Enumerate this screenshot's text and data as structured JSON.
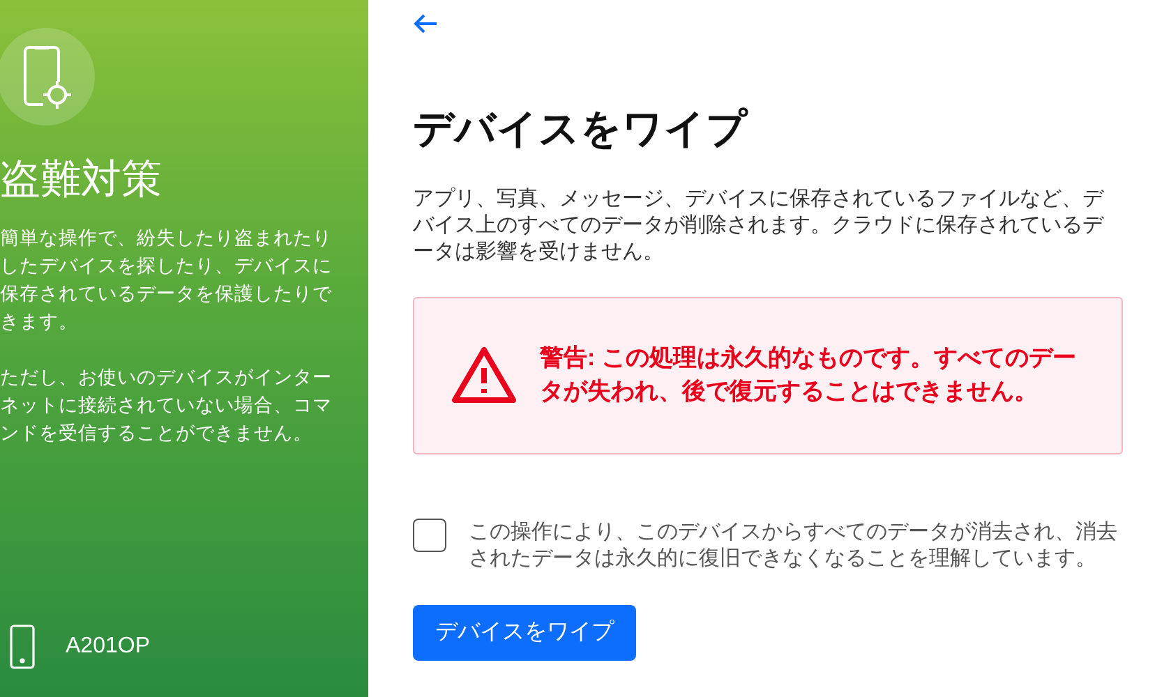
{
  "sidebar": {
    "title": "盗難対策",
    "paragraphs": [
      "簡単な操作で、紛失したり盗まれたりしたデバイスを探したり、デバイスに保存されているデータを保護したりできます。",
      "ただし、お使いのデバイスがインターネットに接続されていない場合、コマンドを受信することができません。"
    ],
    "device": "A201OP"
  },
  "main": {
    "title": "デバイスをワイプ",
    "description": "アプリ、写真、メッセージ、デバイスに保存されているファイルなど、デバイス上のすべてのデータが削除されます。クラウドに保存されているデータは影響を受けません。",
    "warning": "警告: この処理は永久的なものです。すべてのデータが失われ、後で復元することはできません。",
    "confirm": {
      "label": "この操作により、このデバイスからすべてのデータが消去され、消去されたデータは永久的に復旧できなくなることを理解しています。",
      "checked": false
    },
    "button": "デバイスをワイプ"
  }
}
